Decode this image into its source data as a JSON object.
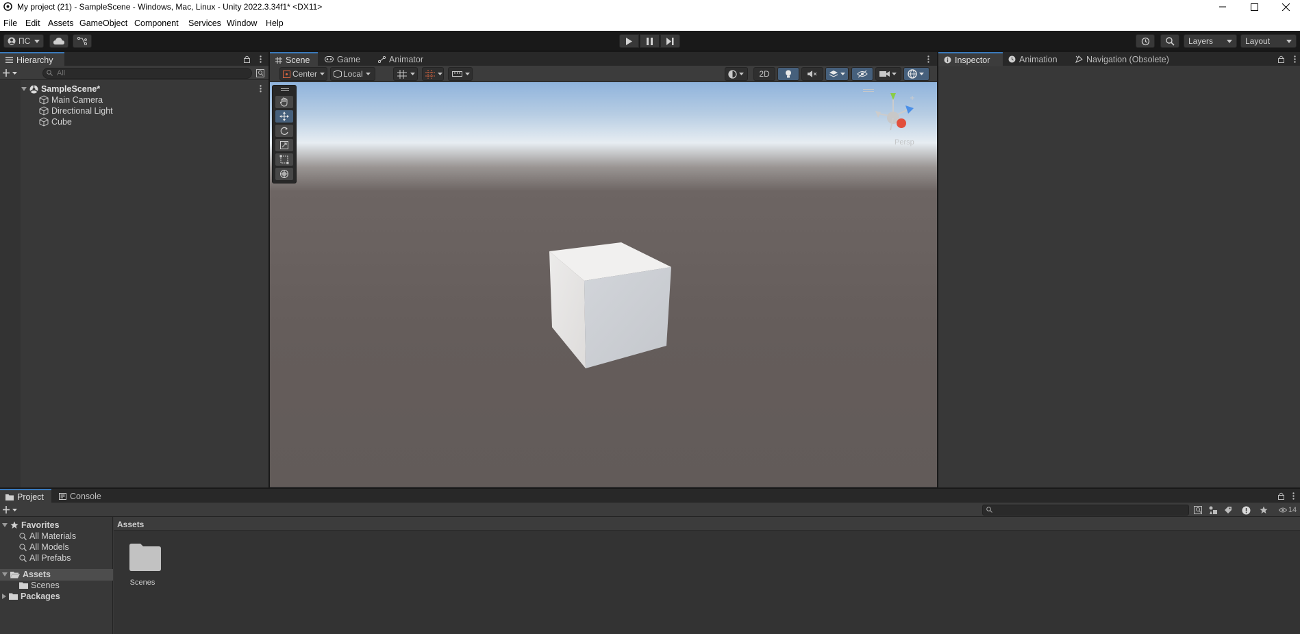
{
  "window": {
    "title": "My project (21) - SampleScene - Windows, Mac, Linux - Unity 2022.3.34f1* <DX11>"
  },
  "menu": [
    "File",
    "Edit",
    "Assets",
    "GameObject",
    "Component",
    "Services",
    "Window",
    "Help"
  ],
  "toolbar": {
    "account_label": "ПС",
    "layers_label": "Layers",
    "layout_label": "Layout"
  },
  "hierarchy": {
    "tab_label": "Hierarchy",
    "search_placeholder": "All",
    "scene_name": "SampleScene*",
    "items": [
      "Main Camera",
      "Directional Light",
      "Cube"
    ]
  },
  "scene_tabs": [
    "Scene",
    "Game",
    "Animator"
  ],
  "scene_toolbar": {
    "pivot_label": "Center",
    "space_label": "Local",
    "mode_2d_label": "2D"
  },
  "gizmo": {
    "projection_label": "Persp"
  },
  "inspector_tabs": [
    "Inspector",
    "Animation",
    "Navigation (Obsolete)"
  ],
  "bottom_tabs": [
    "Project",
    "Console"
  ],
  "project": {
    "favorites_label": "Favorites",
    "favorites": [
      "All Materials",
      "All Models",
      "All Prefabs"
    ],
    "assets_label": "Assets",
    "asset_children": [
      "Scenes"
    ],
    "packages_label": "Packages",
    "breadcrumb": "Assets",
    "folders": [
      "Scenes"
    ],
    "hidden_count": "14"
  },
  "colors": {
    "accent": "#3a79bb",
    "selected_tool": "#46607c",
    "panel_bg": "#383838"
  }
}
